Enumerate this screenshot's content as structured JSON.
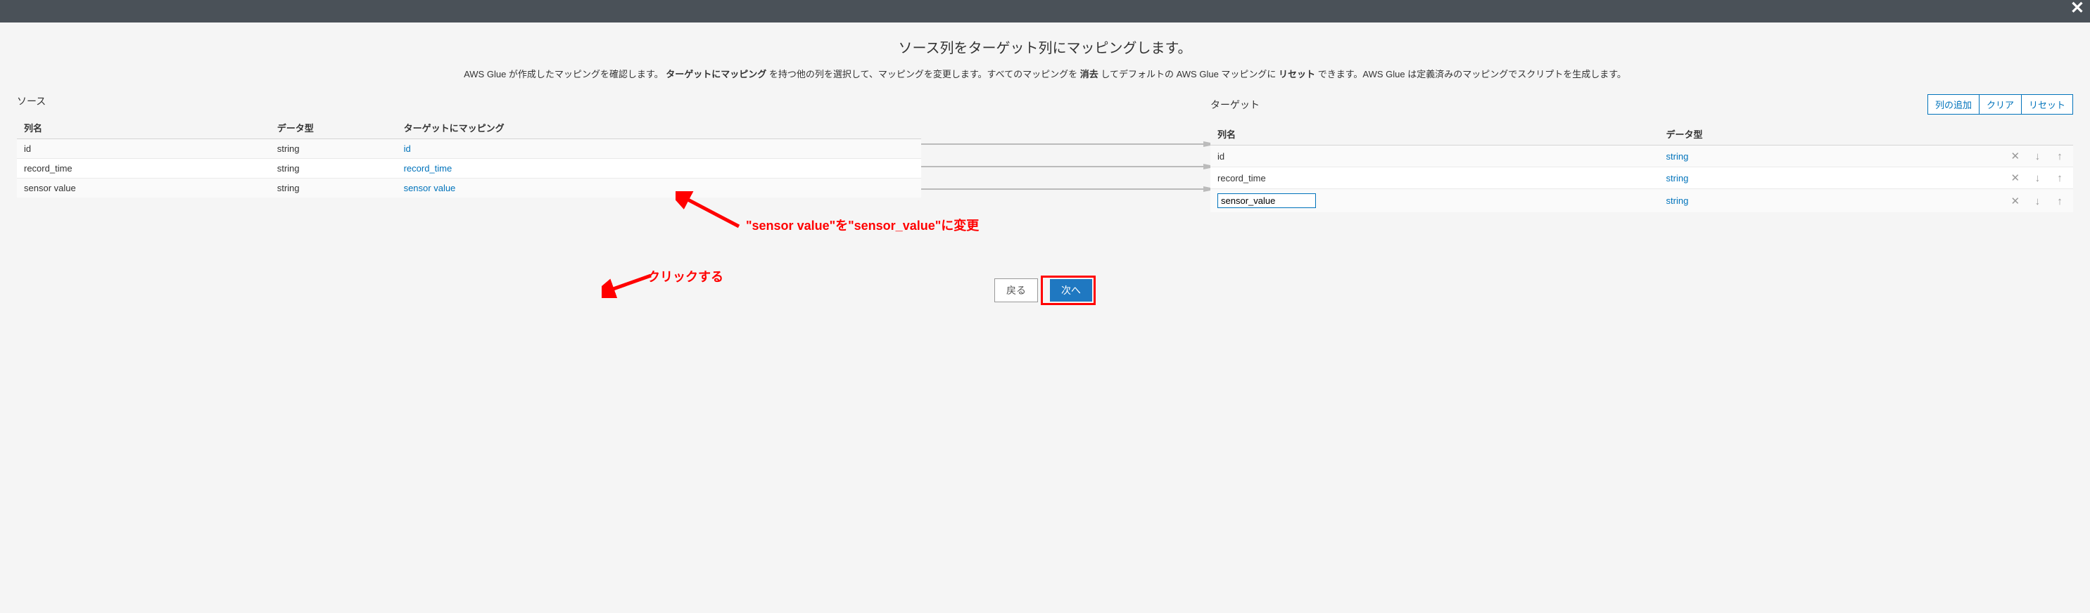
{
  "top": {
    "close": "✕"
  },
  "title": "ソース列をターゲット列にマッピングします。",
  "desc_parts": {
    "p1": "AWS Glue が作成したマッピングを確認します。",
    "b1": "ターゲットにマッピング",
    "p2": "を持つ他の列を選択して、マッピングを変更します。すべてのマッピングを",
    "b2": "消去",
    "p3": "してデフォルトの AWS Glue マッピングに",
    "b3": "リセット",
    "p4": "できます。AWS Glue は定義済みのマッピングでスクリプトを生成します。"
  },
  "left": {
    "section": "ソース",
    "headers": {
      "name": "列名",
      "type": "データ型",
      "map": "ターゲットにマッピング"
    },
    "rows": [
      {
        "name": "id",
        "type": "string",
        "map": "id"
      },
      {
        "name": "record_time",
        "type": "string",
        "map": "record_time"
      },
      {
        "name": "sensor value",
        "type": "string",
        "map": "sensor value"
      }
    ]
  },
  "right": {
    "section": "ターゲット",
    "btns": {
      "add": "列の追加",
      "clear": "クリア",
      "reset": "リセット"
    },
    "headers": {
      "name": "列名",
      "type": "データ型"
    },
    "rows": [
      {
        "name": "id",
        "type": "string",
        "editing": false
      },
      {
        "name": "record_time",
        "type": "string",
        "editing": false
      },
      {
        "name": "sensor_value",
        "type": "string",
        "editing": true
      }
    ]
  },
  "footer": {
    "back": "戻る",
    "next": "次へ"
  },
  "annotation": {
    "a1": "\"sensor value\"を\"sensor_value\"に変更",
    "a2": "クリックする"
  }
}
